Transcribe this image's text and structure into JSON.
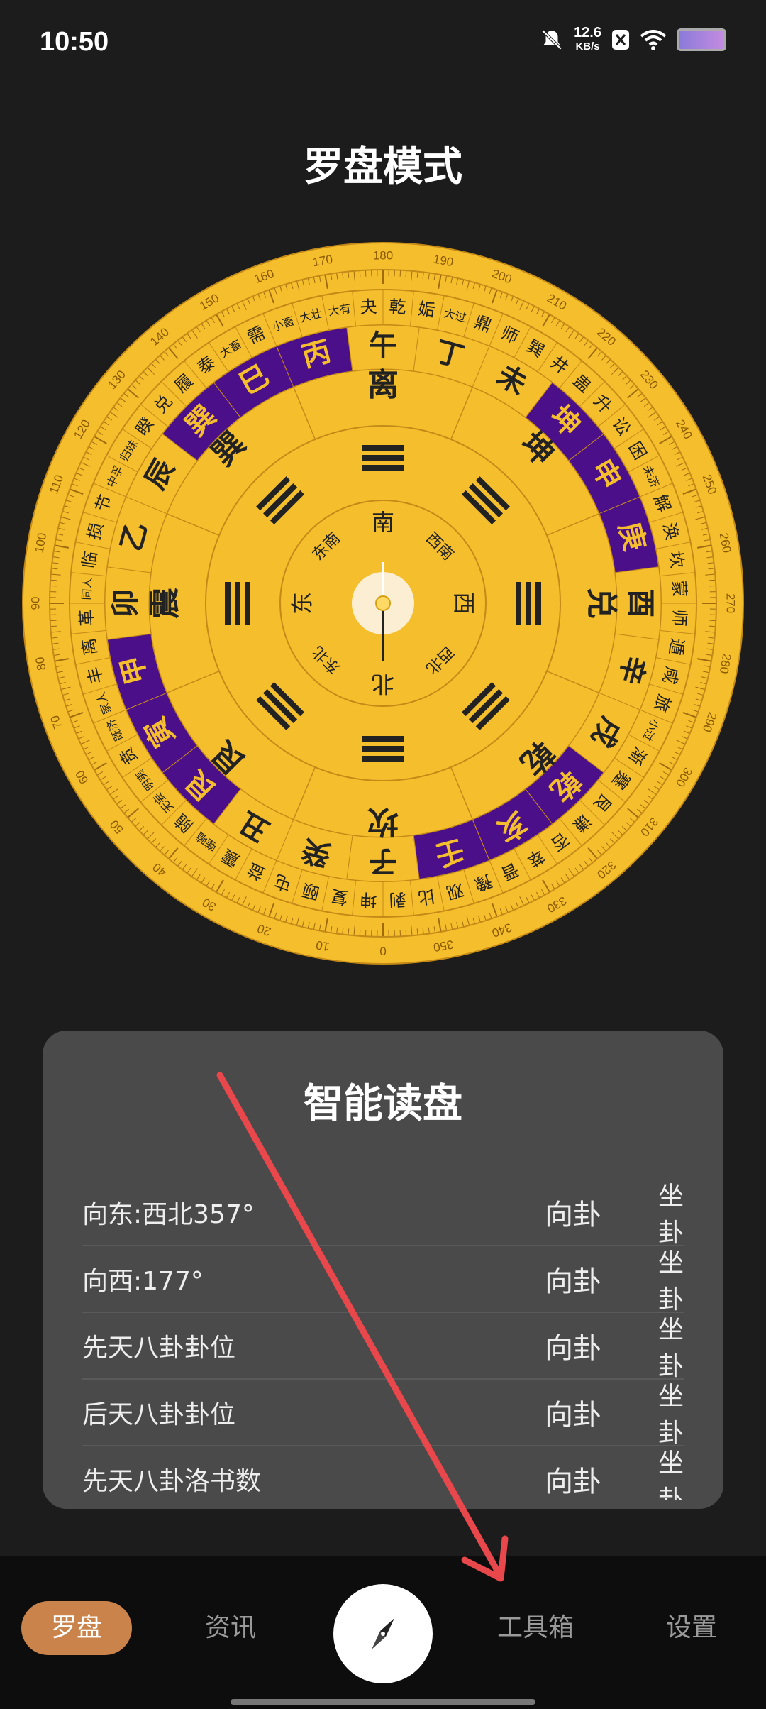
{
  "status": {
    "time": "10:50",
    "net_speed": "12.6",
    "net_unit": "KB/s"
  },
  "title": "罗盘模式",
  "compass": {
    "directions": [
      "南",
      "西南",
      "西",
      "西北",
      "北",
      "东北",
      "东",
      "东南"
    ],
    "ring2_bagua": [
      "离",
      "坤",
      "兑",
      "乾",
      "坎",
      "艮",
      "震",
      "巽"
    ],
    "ring3_mountains": [
      "午",
      "丁",
      "未",
      "坤",
      "申",
      "庚",
      "酉",
      "辛",
      "戌",
      "乾",
      "亥",
      "壬",
      "子",
      "癸",
      "丑",
      "艮",
      "寅",
      "甲",
      "卯",
      "乙",
      "辰",
      "巽",
      "巳",
      "丙"
    ],
    "ring4_hexagrams": [
      "乾",
      "姤",
      "大过",
      "鼎",
      "师",
      "巽",
      "井",
      "蛊",
      "升",
      "讼",
      "困",
      "未济",
      "解",
      "涣",
      "坎",
      "蒙",
      "师",
      "遁",
      "咸",
      "旅",
      "小过",
      "渐",
      "蹇",
      "艮",
      "谦",
      "否",
      "萃",
      "晋",
      "豫",
      "观",
      "比",
      "剥",
      "坤",
      "复",
      "颐",
      "屯",
      "益",
      "震",
      "噬嗑",
      "随",
      "无妄",
      "明夷",
      "贲",
      "既济",
      "家人",
      "丰",
      "离",
      "革",
      "同人",
      "临",
      "损",
      "节",
      "中孚",
      "归妹",
      "睽",
      "兑",
      "履",
      "泰",
      "大畜",
      "需",
      "小畜",
      "大壮",
      "大有",
      "夬"
    ],
    "degree_labels": [
      "180",
      "190",
      "200",
      "210",
      "220",
      "230",
      "240",
      "250",
      "260",
      "270",
      "280",
      "290",
      "300",
      "310",
      "320",
      "330",
      "340",
      "350",
      "0",
      "10",
      "20",
      "30",
      "40",
      "50",
      "60",
      "70",
      "80",
      "90",
      "100",
      "110",
      "120",
      "130",
      "140",
      "150",
      "160",
      "170"
    ]
  },
  "reading": {
    "title": "智能读盘",
    "rows": [
      {
        "label": "向东:西北357°",
        "a": "向卦",
        "b": "坐卦"
      },
      {
        "label": "向西:177°",
        "a": "向卦",
        "b": "坐卦"
      },
      {
        "label": "先天八卦卦位",
        "a": "向卦",
        "b": "坐卦"
      },
      {
        "label": "后天八卦卦位",
        "a": "向卦",
        "b": "坐卦"
      },
      {
        "label": "先天八卦洛书数",
        "a": "向卦",
        "b": "坐卦"
      }
    ]
  },
  "nav": {
    "compass": "罗盘",
    "news": "资讯",
    "tools": "工具箱",
    "settings": "设置"
  },
  "colors": {
    "disc": "#F5BE2C",
    "purple": "#4B0F8A",
    "accent": "#C9834B",
    "arrow": "#E8474B"
  }
}
